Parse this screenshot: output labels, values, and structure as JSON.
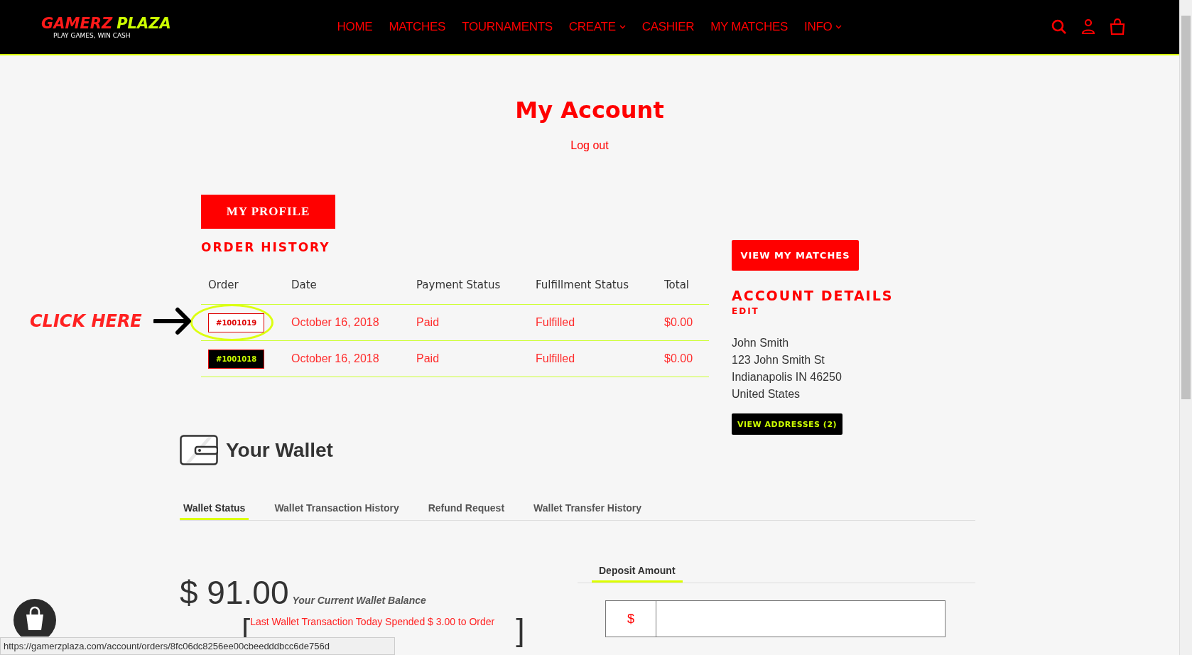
{
  "header": {
    "logo": {
      "word_1": "GAMERZ",
      "word_2": "PLAZA",
      "tagline": "PLAY GAMES, WIN CASH"
    },
    "nav": [
      {
        "label": "HOME",
        "dropdown": false
      },
      {
        "label": "MATCHES",
        "dropdown": false
      },
      {
        "label": "TOURNAMENTS",
        "dropdown": false
      },
      {
        "label": "CREATE",
        "dropdown": true
      },
      {
        "label": "CASHIER",
        "dropdown": false
      },
      {
        "label": "MY MATCHES",
        "dropdown": false
      },
      {
        "label": "INFO",
        "dropdown": true
      }
    ]
  },
  "page": {
    "title": "My Account",
    "logout": "Log out"
  },
  "profile_button": "MY PROFILE",
  "order_history": {
    "title": "ORDER HISTORY",
    "columns": [
      "Order",
      "Date",
      "Payment Status",
      "Fulfillment Status",
      "Total"
    ],
    "rows": [
      {
        "order": "#1001019",
        "kind": "outline",
        "circled": true,
        "date": "October 16, 2018",
        "payment": "Paid",
        "fulfillment": "Fulfilled",
        "total": "$0.00"
      },
      {
        "order": "#1001018",
        "kind": "filled",
        "circled": false,
        "date": "October 16, 2018",
        "payment": "Paid",
        "fulfillment": "Fulfilled",
        "total": "$0.00"
      }
    ]
  },
  "annotation": {
    "text": "CLICK HERE"
  },
  "account": {
    "matches_button": "VIEW MY MATCHES",
    "title": "ACCOUNT DETAILS",
    "edit": "EDIT",
    "address": [
      "John Smith",
      "123 John Smith St",
      "Indianapolis IN 46250",
      "United States"
    ],
    "addresses_button": "VIEW ADDRESSES (2)"
  },
  "wallet": {
    "title": "Your Wallet",
    "tabs": [
      {
        "label": "Wallet Status",
        "selected": true
      },
      {
        "label": "Wallet Transaction History",
        "selected": false
      },
      {
        "label": "Refund Request",
        "selected": false
      },
      {
        "label": "Wallet Transfer History",
        "selected": false
      }
    ],
    "balance": "$ 91.00",
    "balance_label": "Your Current Wallet Balance",
    "bracket_open": "[",
    "last_transaction": "Last Wallet Transaction Today Spended $ 3.00 to Order",
    "bracket_close": "]",
    "deposit": {
      "tab": "Deposit Amount",
      "currency": "$"
    }
  },
  "status_bar": {
    "url": "https://gamerzplaza.com/account/orders/8fc06dc8256ee00cbeedddbcc6de756d"
  }
}
